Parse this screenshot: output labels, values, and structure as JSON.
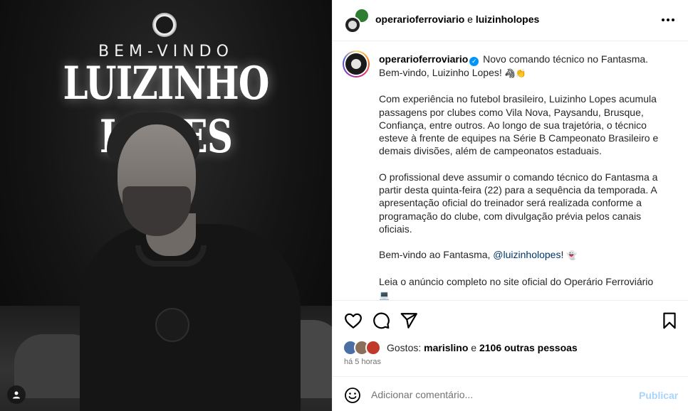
{
  "media": {
    "kicker": "BEM-VINDO",
    "headline": "LUIZINHO LOPES"
  },
  "header": {
    "account": "operarioferroviario",
    "connector": "e",
    "collaborator": "luizinholopes"
  },
  "caption": {
    "username": "operarioferroviario",
    "line1_text": "Novo comando técnico no Fantasma. Bem-vindo, Luizinho Lopes!",
    "line1_emoji": "🦓👏",
    "paragraph2": "Com experiência no futebol brasileiro, Luizinho Lopes acumula passagens por clubes como Vila Nova, Paysandu, Brusque, Confiança, entre outros. Ao longo de sua trajetória, o técnico esteve à frente de equipes na Série B Campeonato Brasileiro e demais divisões, além de campeonatos estaduais.",
    "paragraph3": "O profissional deve assumir o comando técnico do Fantasma a partir desta quinta-feira (22) para a sequência da temporada. A apresentação oficial do treinador será realizada conforme a programação do clube, com divulgação prévia pelos canais oficiais.",
    "paragraph4_text": "Bem-vindo ao Fantasma,",
    "paragraph4_mention": "@luizinholopes",
    "paragraph4_end": "!",
    "paragraph4_emoji": "👻",
    "paragraph5_text": "Leia o anúncio completo no site oficial do Operário Ferroviário",
    "paragraph5_emoji": "💻"
  },
  "likes": {
    "prefix": "Gostos:",
    "first_user": "marislino",
    "connector": "e",
    "others": "2106 outras pessoas"
  },
  "time": "há 5 horas",
  "comment": {
    "placeholder": "Adicionar comentário...",
    "publish_label": "Publicar"
  },
  "icons": {
    "like": "heart-icon",
    "comment": "comment-icon",
    "share": "send-icon",
    "save": "bookmark-icon",
    "more": "more-horizontal-icon",
    "emoji": "smiley-icon",
    "user_tag": "user-icon"
  },
  "colors": {
    "link": "#00376b",
    "publish_disabled": "#a8d4fb",
    "verified": "#0095f6",
    "muted": "#737373"
  }
}
